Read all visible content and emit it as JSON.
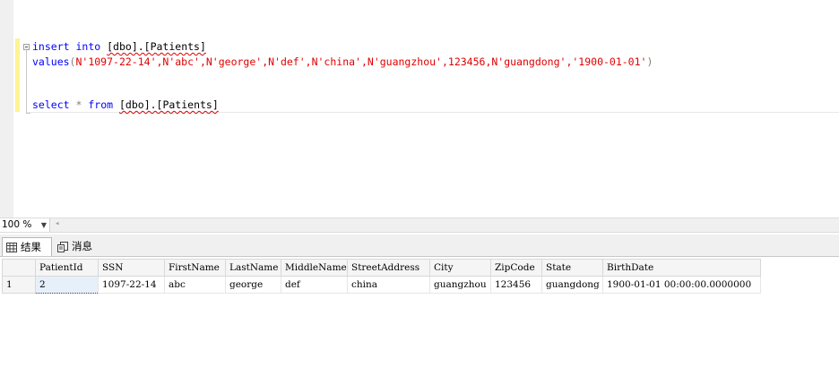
{
  "editor": {
    "line1": {
      "kw1": "insert",
      "kw2": "into",
      "obj": "[dbo].[Patients]"
    },
    "line2": {
      "fn": "values",
      "open": "(",
      "args": "N'1097-22-14',N'abc',N'george',N'def',N'china',N'guangzhou',123456,N'guangdong','1900-01-01'",
      "close": ")"
    },
    "line3": {
      "kw1": "select",
      "star": "*",
      "kw2": "from",
      "obj": "[dbo].[Patients]"
    }
  },
  "status": {
    "zoom": "100 %"
  },
  "tabs": [
    {
      "label": "结果"
    },
    {
      "label": "消息"
    }
  ],
  "grid": {
    "columns": [
      "PatientId",
      "SSN",
      "FirstName",
      "LastName",
      "MiddleName",
      "StreetAddress",
      "City",
      "ZipCode",
      "State",
      "BirthDate"
    ],
    "rows": [
      {
        "rownum": "1",
        "cells": [
          "2",
          "1097-22-14",
          "abc",
          "george",
          "def",
          "china",
          "guangzhou",
          "123456",
          "guangdong",
          "1900-01-01 00:00:00.0000000"
        ]
      }
    ]
  },
  "colors": {
    "keyword": "#0000ff",
    "string": "#e00000",
    "change_bar": "#fff394"
  }
}
